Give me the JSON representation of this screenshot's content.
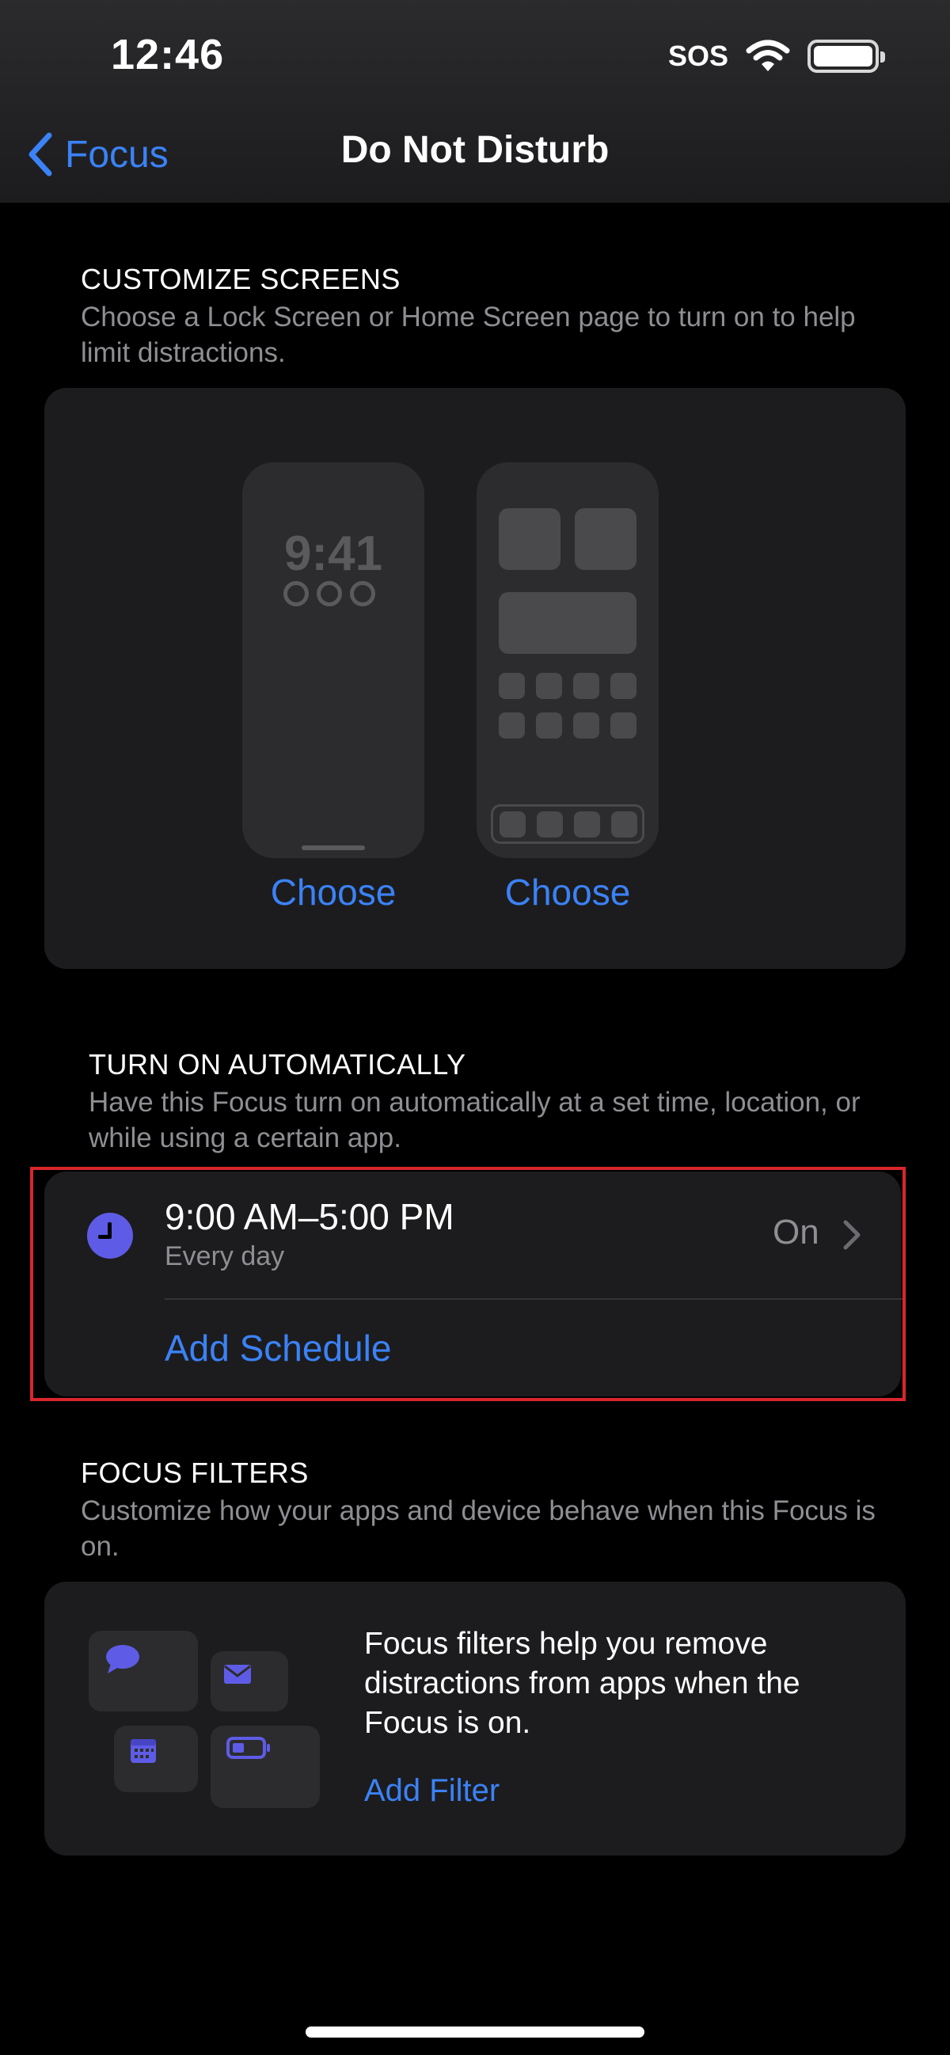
{
  "status_bar": {
    "time": "12:46",
    "carrier": "SOS"
  },
  "nav": {
    "back_label": "Focus",
    "title": "Do Not Disturb"
  },
  "customize": {
    "heading": "CUSTOMIZE SCREENS",
    "description": "Choose a Lock Screen or Home Screen page to turn on to help limit distractions.",
    "lock_preview_time": "9:41",
    "choose_lock_label": "Choose",
    "choose_home_label": "Choose"
  },
  "automation": {
    "heading": "TURN ON AUTOMATICALLY",
    "description": "Have this Focus turn on automatically at a set time, location, or while using a certain app.",
    "schedule": {
      "time_range": "9:00 AM–5:00 PM",
      "repeat": "Every day",
      "state": "On"
    },
    "add_schedule_label": "Add Schedule"
  },
  "filters": {
    "heading": "FOCUS FILTERS",
    "description": "Customize how your apps and device behave when this Focus is on.",
    "info": "Focus filters help you remove distractions from apps when the Focus is on.",
    "add_filter_label": "Add Filter"
  },
  "colors": {
    "accent": "#3b82f6",
    "schedule_icon": "#5e5ce6",
    "highlight_border": "#d9262c",
    "card": "#1c1c1e"
  },
  "icons": [
    "chevron-left-icon",
    "wifi-icon",
    "battery-icon",
    "clock-icon",
    "chevron-right-icon",
    "message-icon",
    "mail-icon",
    "calendar-icon",
    "battery-filter-icon"
  ]
}
